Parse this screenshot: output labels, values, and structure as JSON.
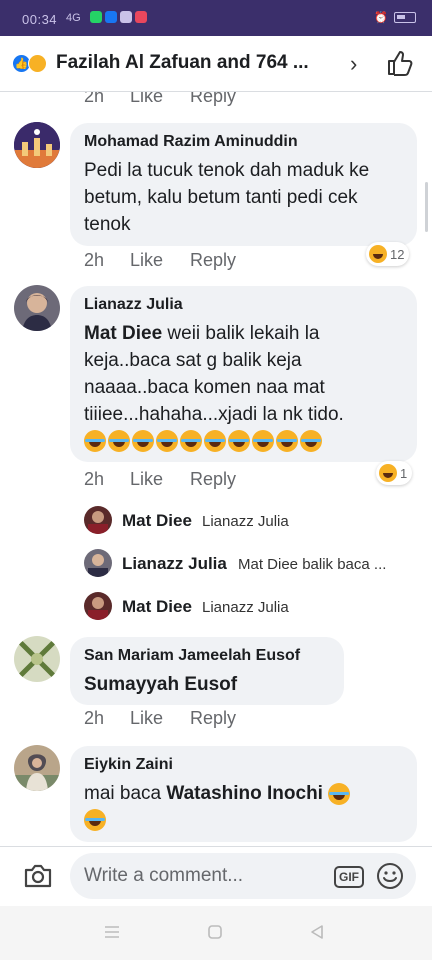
{
  "status_bar": {
    "time": "00:34",
    "signal": "4G"
  },
  "header": {
    "title": "Fazilah Al Zafuan and 764 ..."
  },
  "actions": {
    "time_label": "2h",
    "like_label": "Like",
    "reply_label": "Reply"
  },
  "comments": [
    {
      "author": "Mohamad Razim Aminuddin",
      "text": "Pedi la tucuk tenok dah maduk ke betum, kalu betum tanti pedi cek tenok",
      "reaction_count": "12"
    },
    {
      "author": "Lianazz Julia",
      "tag": "Mat Diee",
      "text": " weii balik lekaih la keja..baca sat g balik keja naaaa..baca komen naa mat tiiiee...hahaha...xjadi la nk tido.",
      "reaction_count": "1"
    },
    {
      "author": "San Mariam Jameelah Eusof",
      "tag": "Sumayyah Eusof"
    },
    {
      "author": "Eiykin Zaini",
      "text": "mai baca ",
      "tag": "Watashino Inochi"
    }
  ],
  "replies": [
    {
      "author": "Mat Diee",
      "text": "Lianazz Julia"
    },
    {
      "author": "Lianazz Julia",
      "text": "Mat Diee balik baca ..."
    },
    {
      "author": "Mat Diee",
      "text": "Lianazz Julia"
    }
  ],
  "composer": {
    "placeholder": "Write a comment...",
    "gif_label": "GIF"
  },
  "colors": {
    "accent": "#1877f2",
    "bubble": "#f0f2f5",
    "status_bar": "#3b2f6b",
    "haha": "#f7b125"
  }
}
